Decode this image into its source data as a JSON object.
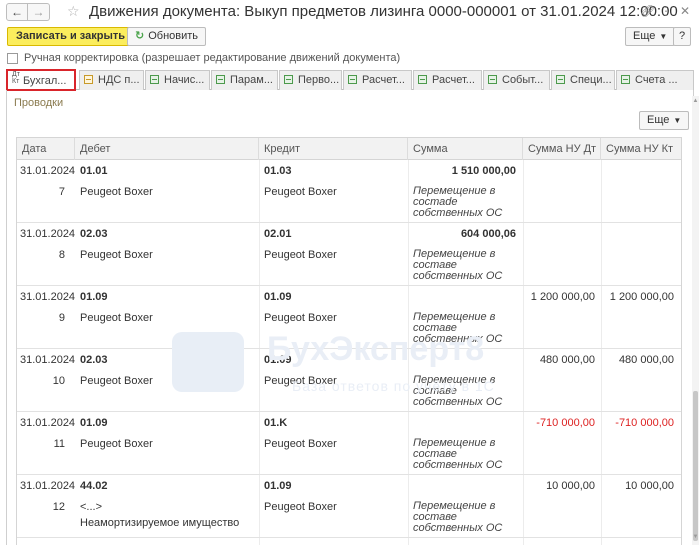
{
  "window": {
    "title": "Движения документа: Выкуп предметов лизинга 0000-000001 от 31.01.2024 12:00:00"
  },
  "toolbar": {
    "save_close_label": "Записать и закрыть",
    "refresh_label": "Обновить",
    "more_label": "Еще"
  },
  "manual_edit": {
    "label": "Ручная корректировка (разрешает редактирование движений документа)",
    "checked": false
  },
  "tabs": [
    {
      "label": "Бухгал...",
      "prefix": "Дт Кт",
      "active": true
    },
    {
      "label": "НДС п...",
      "active": false
    },
    {
      "label": "Начис...",
      "active": false
    },
    {
      "label": "Парам...",
      "active": false
    },
    {
      "label": "Перво...",
      "active": false
    },
    {
      "label": "Расчет...",
      "active": false
    },
    {
      "label": "Расчет...",
      "active": false
    },
    {
      "label": "Событ...",
      "active": false
    },
    {
      "label": "Специ...",
      "active": false
    },
    {
      "label": "Счета ...",
      "active": false
    }
  ],
  "postings": {
    "section_title": "Проводки",
    "more_label": "Еще",
    "columns": [
      "Дата",
      "Дебет",
      "Кредит",
      "Сумма",
      "Сумма НУ Дт",
      "Сумма НУ Кт"
    ],
    "rows": [
      {
        "date": "31.01.2024",
        "n": "7",
        "debit": "01.01",
        "debit_sub": "Peugeot Boxer",
        "debit_sub2": "",
        "credit": "01.03",
        "credit_sub": "Peugeot Boxer",
        "sum": "1 510 000,00",
        "content": "Перемещение в состаdе собственных ОС",
        "nu_dt": "",
        "nu_kt": "",
        "negative": false
      },
      {
        "date": "31.01.2024",
        "n": "8",
        "debit": "02.03",
        "debit_sub": "Peugeot Boxer",
        "debit_sub2": "",
        "credit": "02.01",
        "credit_sub": "Peugeot Boxer",
        "sum": "604 000,06",
        "content": "Перемещение в составе собственных ОС",
        "nu_dt": "",
        "nu_kt": "",
        "negative": false
      },
      {
        "date": "31.01.2024",
        "n": "9",
        "debit": "01.09",
        "debit_sub": "Peugeot Boxer",
        "debit_sub2": "",
        "credit": "01.09",
        "credit_sub": "Peugeot Boxer",
        "sum": "",
        "content": "Перемещение в составе собственных ОС",
        "nu_dt": "1 200 000,00",
        "nu_kt": "1 200 000,00",
        "negative": false
      },
      {
        "date": "31.01.2024",
        "n": "10",
        "debit": "02.03",
        "debit_sub": "Peugeot Boxer",
        "debit_sub2": "",
        "credit": "01.09",
        "credit_sub": "Peugeot Boxer",
        "sum": "",
        "content": "Перемещение в составе собственных ОС",
        "nu_dt": "480 000,00",
        "nu_kt": "480 000,00",
        "negative": false
      },
      {
        "date": "31.01.2024",
        "n": "11",
        "debit": "01.09",
        "debit_sub": "Peugeot Boxer",
        "debit_sub2": "",
        "credit": "01.K",
        "credit_sub": "Peugeot Boxer",
        "sum": "",
        "content": "Перемещение в составе собственных ОС",
        "nu_dt": "-710 000,00",
        "nu_kt": "-710 000,00",
        "negative": true
      },
      {
        "date": "31.01.2024",
        "n": "12",
        "debit": "44.02",
        "debit_sub": "<...>",
        "debit_sub2": "Неамортизируемое имущество",
        "credit": "01.09",
        "credit_sub": "Peugeot Boxer",
        "sum": "",
        "content": "Перемещение в составе собственных ОС",
        "nu_dt": "10 000,00",
        "nu_kt": "10 000,00",
        "negative": false
      }
    ]
  },
  "watermark": {
    "brand": "БухЭксперт8",
    "tagline": "База ответов по учёту в 1С"
  },
  "colors": {
    "primary_button": "#fbed5d",
    "active_tab_border": "#d9252b",
    "negative_value": "#dd2222",
    "section_title": "#8a7a4e"
  }
}
